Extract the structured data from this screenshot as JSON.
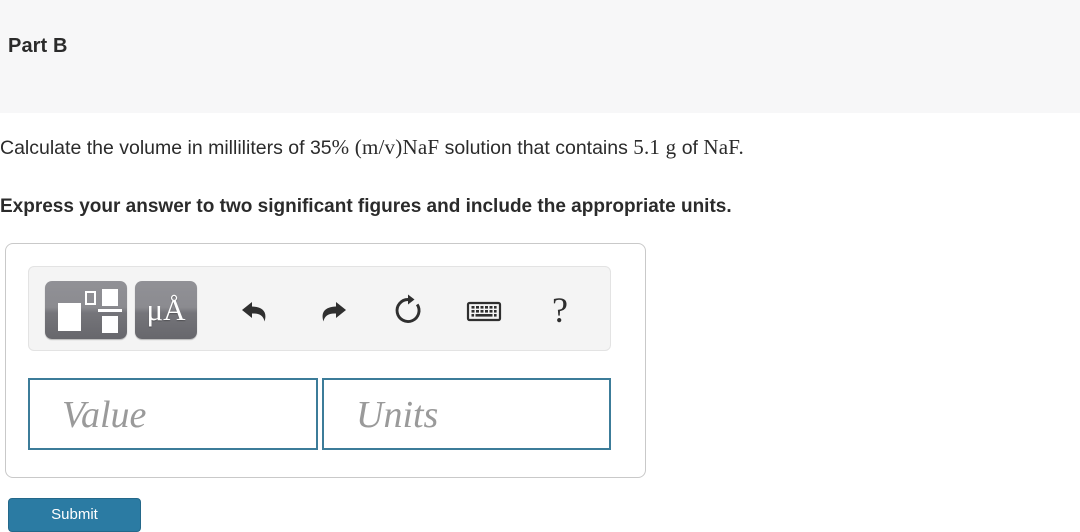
{
  "header": {
    "part_label": "Part B",
    "background_color": "#f7f7f8"
  },
  "question": {
    "text_part_1": "Calculate the volume in milliliters of ",
    "math_quantity": "35",
    "math_percent": "% (m/v)",
    "math_compound_1": "NaF",
    "text_part_2": " solution that contains ",
    "math_mass": "5.1 g",
    "text_part_3": " of ",
    "math_compound_2": "NaF",
    "text_part_4": ".",
    "instruction": "Express your answer to two significant figures and include the appropriate units."
  },
  "answer_box": {
    "toolbar": {
      "template_button_label": "template-button",
      "units_button_label": "μÅ",
      "undo_label": "undo",
      "redo_label": "redo",
      "reset_label": "reset",
      "keyboard_label": "keyboard shortcuts",
      "help_label": "?"
    },
    "value_field": {
      "placeholder": "Value",
      "value": ""
    },
    "units_field": {
      "placeholder": "Units",
      "value": ""
    },
    "border_color": "#c9c9c9",
    "field_border_color": "#3c7c99"
  },
  "submit": {
    "label": "Submit",
    "color": "#2b7ba3"
  }
}
